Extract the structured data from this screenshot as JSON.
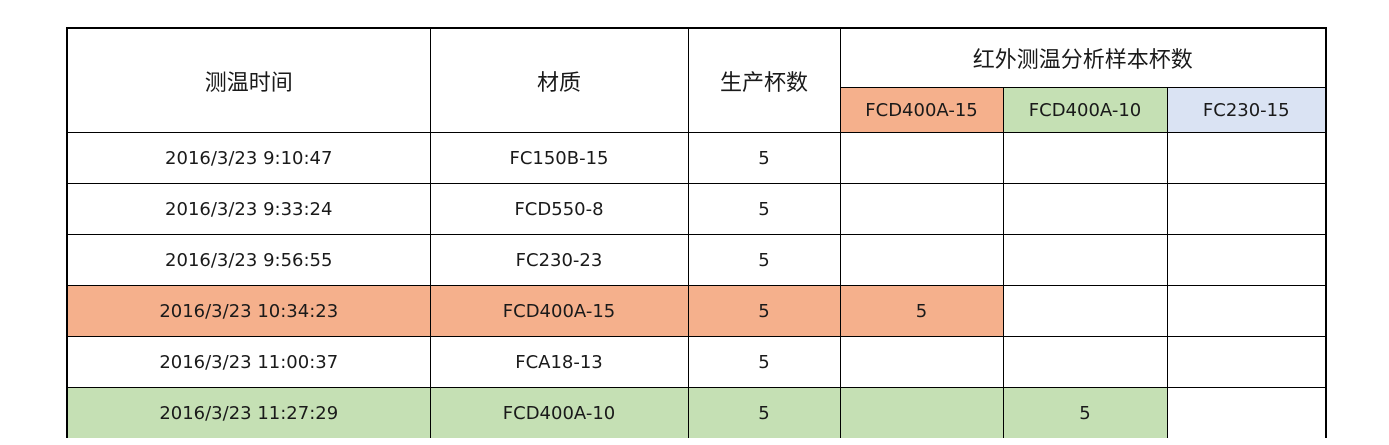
{
  "table": {
    "headers": {
      "time": "测温时间",
      "material": "材质",
      "count": "生产杯数",
      "ir_group": "红外测温分析样本杯数",
      "ir_cols": [
        "FCD400A-15",
        "FCD400A-10",
        "FC230-15"
      ]
    },
    "ir_col_colors": [
      "#f5b08c",
      "#c5e0b4",
      "#dae3f3"
    ],
    "rows": [
      {
        "time": "2016/3/23 9:10:47",
        "material": "FC150B-15",
        "count": "5",
        "ir": [
          "",
          "",
          ""
        ],
        "highlight": ""
      },
      {
        "time": "2016/3/23 9:33:24",
        "material": "FCD550-8",
        "count": "5",
        "ir": [
          "",
          "",
          ""
        ],
        "highlight": ""
      },
      {
        "time": "2016/3/23 9:56:55",
        "material": "FC230-23",
        "count": "5",
        "ir": [
          "",
          "",
          ""
        ],
        "highlight": ""
      },
      {
        "time": "2016/3/23 10:34:23",
        "material": "FCD400A-15",
        "count": "5",
        "ir": [
          "5",
          "",
          ""
        ],
        "highlight": "#f5b08c"
      },
      {
        "time": "2016/3/23 11:00:37",
        "material": "FCA18-13",
        "count": "5",
        "ir": [
          "",
          "",
          ""
        ],
        "highlight": ""
      },
      {
        "time": "2016/3/23 11:27:29",
        "material": "FCD400A-10",
        "count": "5",
        "ir": [
          "",
          "5",
          ""
        ],
        "highlight": "#c5e0b4"
      }
    ]
  }
}
